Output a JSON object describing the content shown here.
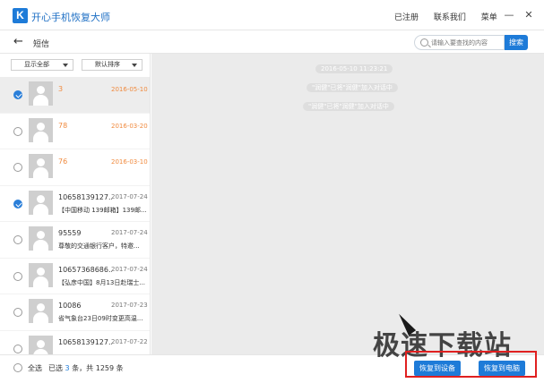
{
  "app": {
    "title": "开心手机恢复大师",
    "logo_letter": "K"
  },
  "titlebar": {
    "links": [
      "已注册",
      "联系我们",
      "菜单"
    ],
    "minimize": "—",
    "close": "✕"
  },
  "toolbar": {
    "page_title": "短信",
    "search_placeholder": "请输入要查找的内容",
    "search_button": "搜索"
  },
  "filters": {
    "show": "显示全部",
    "sort": "默认排序"
  },
  "messages": [
    {
      "contact": "3",
      "date": "2016-05-10",
      "preview": "",
      "highlight": true,
      "checked": true,
      "selected": true
    },
    {
      "contact": "78",
      "date": "2016-03-20",
      "preview": "",
      "highlight": true,
      "checked": false,
      "selected": false
    },
    {
      "contact": "76",
      "date": "2016-03-10",
      "preview": "",
      "highlight": true,
      "checked": false,
      "selected": false
    },
    {
      "contact": "10658139127...",
      "date": "2017-07-24",
      "preview": "【中国移动 139邮箱】139邮...",
      "highlight": false,
      "checked": true,
      "selected": false
    },
    {
      "contact": "95559",
      "date": "2017-07-24",
      "preview": "尊敬的交通银行客户，特邀...",
      "highlight": false,
      "checked": false,
      "selected": false
    },
    {
      "contact": "10657368686...",
      "date": "2017-07-24",
      "preview": "【弘彦中国】8月13日赴瑞士...",
      "highlight": false,
      "checked": false,
      "selected": false
    },
    {
      "contact": "10086",
      "date": "2017-07-23",
      "preview": "省气象台23日09时变更高温...",
      "highlight": false,
      "checked": false,
      "selected": false
    },
    {
      "contact": "10658139127...",
      "date": "2017-07-22",
      "preview": "",
      "highlight": false,
      "checked": false,
      "selected": false
    }
  ],
  "conversation": {
    "timestamp": "2016-05-10 11:23:21",
    "notices": [
      "\"润健\"已将\"润健\"加入对话中",
      "\"润健\"已将\"润健\"加入对话中"
    ]
  },
  "footer": {
    "select_all": "全选",
    "selected_prefix": "已选",
    "selected_count": "3",
    "selected_suffix": "条，共 1259 条",
    "restore_device": "恢复到设备",
    "restore_pc": "恢复到电脑"
  },
  "watermark": {
    "text": "极速下载站"
  },
  "colors": {
    "accent": "#1e7bd8",
    "highlight": "#f08a3e",
    "watermark_frame": "#e02020"
  }
}
